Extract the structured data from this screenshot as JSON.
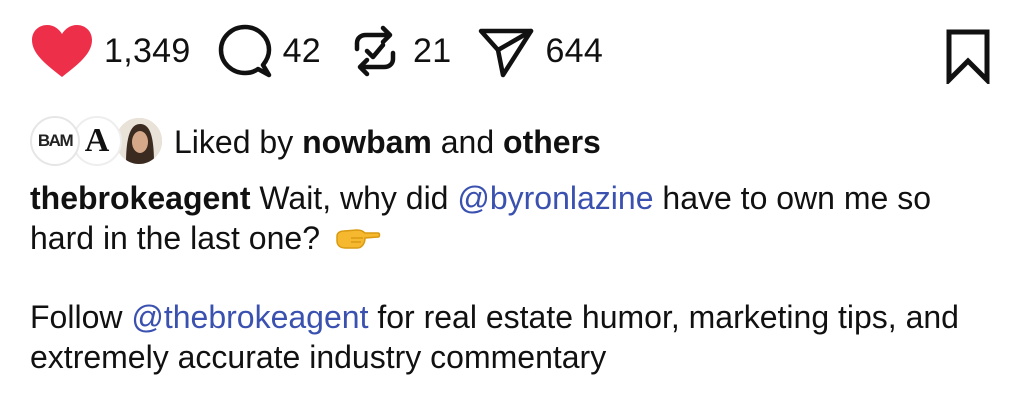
{
  "actions": {
    "likes": "1,349",
    "comments": "42",
    "reposts": "21",
    "shares": "644",
    "like_color": "#ed2f4a",
    "icons": [
      "heart-icon",
      "comment-icon",
      "repost-icon",
      "share-icon",
      "bookmark-icon"
    ]
  },
  "liked_by": {
    "prefix": "Liked by ",
    "user": "nowbam",
    "middle": " and ",
    "others": "others",
    "avatars": [
      {
        "text": "BAM"
      },
      {
        "text": "A"
      },
      {
        "text": ""
      }
    ]
  },
  "caption": {
    "username": "thebrokeagent",
    "text1": " Wait, why did ",
    "mention1": "@byronlazine",
    "text2": " have to own me so hard in the last one? ",
    "emoji": "pointing-right-emoji",
    "follow": "Follow ",
    "mention2": "@thebrokeagent",
    "text3": " for real estate humor, marketing tips, and extremely accurate industry commentary"
  },
  "colors": {
    "mention": "#3b51b0",
    "text": "#111111"
  }
}
